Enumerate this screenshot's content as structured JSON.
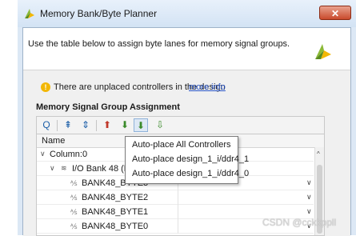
{
  "window": {
    "title": "Memory Bank/Byte Planner",
    "close_glyph": "✕",
    "app_icon": "vivado-logo-icon",
    "accent_color": "#f2b705",
    "brand_logo": "vivado-logo-icon"
  },
  "header": {
    "description": "Use the table below to assign byte lanes for memory signal groups."
  },
  "warning": {
    "icon": "warning-icon",
    "glyph": "!",
    "text": "There are unplaced controllers in the design",
    "link": "more info"
  },
  "section": {
    "title": "Memory Signal Group Assignment"
  },
  "toolbar": {
    "buttons": [
      {
        "name": "search-icon",
        "glyph": "Q"
      },
      {
        "name": "collapse-all-icon",
        "glyph": "⇞"
      },
      {
        "name": "expand-all-icon",
        "glyph": "⇕"
      },
      {
        "name": "auto-place-byte-icon",
        "glyph": "⬆"
      },
      {
        "name": "auto-place-controllers-icon",
        "glyph": "⬇"
      },
      {
        "name": "unplace-icon",
        "glyph": "⇩"
      }
    ]
  },
  "table": {
    "column_name": "Name",
    "rows": [
      {
        "label": "Column:0",
        "expand": "∨"
      },
      {
        "label": "I/O Bank 48 (High",
        "expand": "∨",
        "icon": "io-bank-icon",
        "icon_glyph": "≋"
      },
      {
        "label": "BANK48_BYTE3",
        "icon": "byte-lane-icon",
        "icon_glyph": "⅍",
        "chevron": "∨"
      },
      {
        "label": "BANK48_BYTE2",
        "icon": "byte-lane-icon",
        "icon_glyph": "⅍",
        "chevron": "∨"
      },
      {
        "label": "BANK48_BYTE1",
        "icon": "byte-lane-icon",
        "icon_glyph": "⅍",
        "chevron": "∨"
      },
      {
        "label": "BANK48_BYTE0",
        "icon": "byte-lane-icon",
        "icon_glyph": "⅍",
        "chevron": "∨"
      }
    ],
    "scroll_up_glyph": "^"
  },
  "popup_menu": {
    "items": [
      "Auto-place All Controllers",
      "Auto-place design_1_i/ddr4_1",
      "Auto-place design_1_i/ddr4_0"
    ]
  },
  "watermark": "CSDN @cckkppll"
}
